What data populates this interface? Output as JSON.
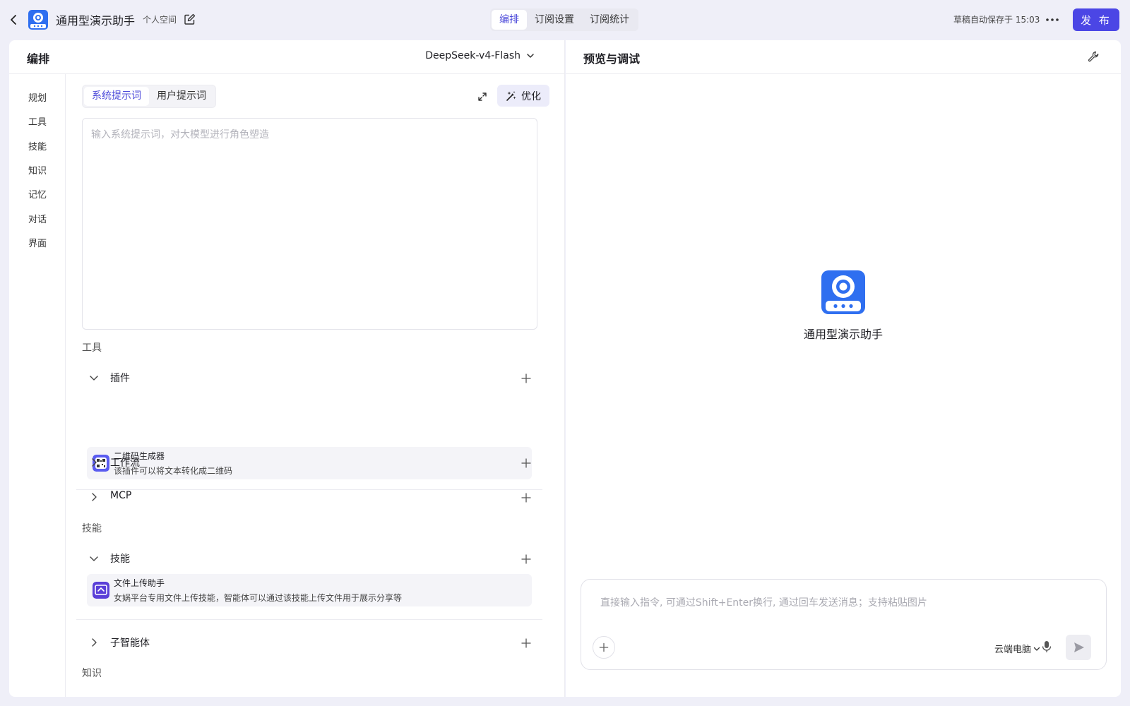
{
  "header": {
    "title": "通用型演示助手",
    "space": "个人空间",
    "tabs": [
      {
        "label": "编排",
        "active": true
      },
      {
        "label": "订阅设置",
        "active": false
      },
      {
        "label": "订阅统计",
        "active": false
      }
    ],
    "save_status": "草稿自动保存于 15:03",
    "publish_label": "发 布"
  },
  "colors": {
    "accent": "#4b46e5",
    "avatar_blue": "#2f6ff0",
    "page_bg": "#efeff8"
  },
  "editor": {
    "title": "编排",
    "model": "DeepSeek-v4-Flash",
    "nav": [
      "规划",
      "工具",
      "技能",
      "知识",
      "记忆",
      "对话",
      "界面"
    ],
    "prompt_tabs": [
      {
        "label": "系统提示词",
        "active": true
      },
      {
        "label": "用户提示词",
        "active": false
      }
    ],
    "optimize_label": "优化",
    "prompt_placeholder": "输入系统提示词，对大模型进行角色塑造",
    "sections": {
      "tools": {
        "label": "工具",
        "groups": {
          "plugins": {
            "title": "插件",
            "expanded": true,
            "items": [
              {
                "name": "二维码生成器",
                "desc": "该插件可以将文本转化成二维码",
                "icon": "qr-plugin-icon"
              }
            ]
          },
          "workflow": {
            "title": "工作流",
            "expanded": false
          },
          "mcp": {
            "title": "MCP",
            "expanded": false
          }
        }
      },
      "skills": {
        "label": "技能",
        "groups": {
          "skills": {
            "title": "技能",
            "expanded": true,
            "items": [
              {
                "name": "文件上传助手",
                "desc": "女娲平台专用文件上传技能，智能体可以通过该技能上传文件用于展示分享等",
                "icon": "upload-skill-icon"
              }
            ]
          },
          "sub_agents": {
            "title": "子智能体",
            "expanded": false
          }
        }
      },
      "knowledge": {
        "label": "知识"
      }
    }
  },
  "preview": {
    "title": "预览与调试",
    "bot_name": "通用型演示助手",
    "input_placeholder": "直接输入指令, 可通过Shift+Enter换行, 通过回车发送消息；支持粘贴图片",
    "device_label": "云端电脑"
  }
}
